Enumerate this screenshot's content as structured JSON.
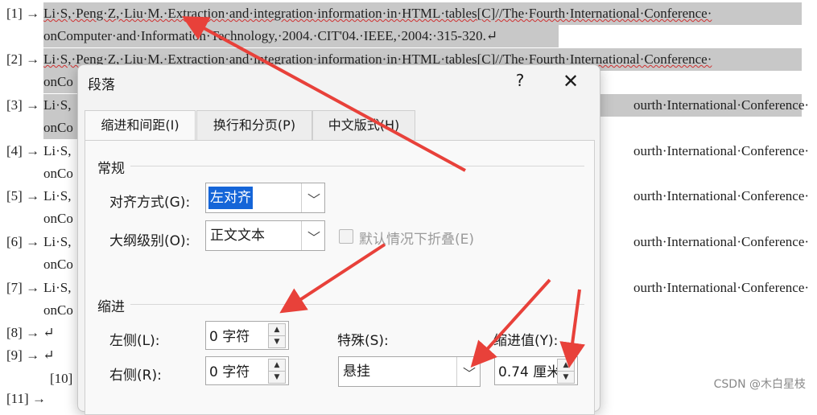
{
  "document": {
    "references": [
      {
        "num": "[1] →",
        "line1": "Li·S,·Peng·Z,·Liu·M.·Extraction·and·integration·information·in·HTML·tables[C]//The·Fourth·International·Conference·",
        "line2": "onComputer·and·Information·Technology,·2004.·CIT'04.·IEEE,·2004:·315-320.↵"
      },
      {
        "num": "[2] →",
        "line1": "Li·S,·Peng·Z,·Liu·M.·Extraction·and·integration·information·in·HTML·tables[C]//The·Fourth·International·Conference·",
        "line2": "onCo"
      },
      {
        "num": "[3] →",
        "line1": "Li·S,",
        "tail": "ourth·International·Conference·",
        "line2": "onCo"
      },
      {
        "num": "[4] →",
        "line1": "Li·S,",
        "tail": "ourth·International·Conference·",
        "line2": "onCo"
      },
      {
        "num": "[5] →",
        "line1": "Li·S,",
        "tail": "ourth·International·Conference·",
        "line2": "onCo"
      },
      {
        "num": "[6] →",
        "line1": "Li·S,",
        "tail": "ourth·International·Conference·",
        "line2": "onCo"
      },
      {
        "num": "[7] →",
        "line1": "Li·S,",
        "tail": "ourth·International·Conference·",
        "line2": "onCo"
      }
    ],
    "empty_items": [
      "[8] → ↵",
      "[9] → ↵",
      "[10]",
      "[11] →"
    ],
    "watermark": "CSDN @木白星枝"
  },
  "dialog": {
    "title": "段落",
    "help_label": "?",
    "close_label": "✕",
    "tabs": [
      "缩进和间距(I)",
      "换行和分页(P)",
      "中文版式(H)"
    ],
    "general": {
      "heading": "常规",
      "alignment_label": "对齐方式(G):",
      "alignment_value": "左对齐",
      "outline_label": "大纲级别(O):",
      "outline_value": "正文文本",
      "collapse_label": "默认情况下折叠(E)"
    },
    "indent": {
      "heading": "缩进",
      "left_label": "左侧(L):",
      "left_value": "0 字符",
      "right_label": "右侧(R):",
      "right_value": "0 字符",
      "special_label": "特殊(S):",
      "special_value": "悬挂",
      "by_label": "缩进值(Y):",
      "by_value": "0.74 厘米"
    }
  },
  "colors": {
    "selection": "#1565d8",
    "annotation_arrow": "#e8413a",
    "highlight": "#c8c8c8"
  }
}
